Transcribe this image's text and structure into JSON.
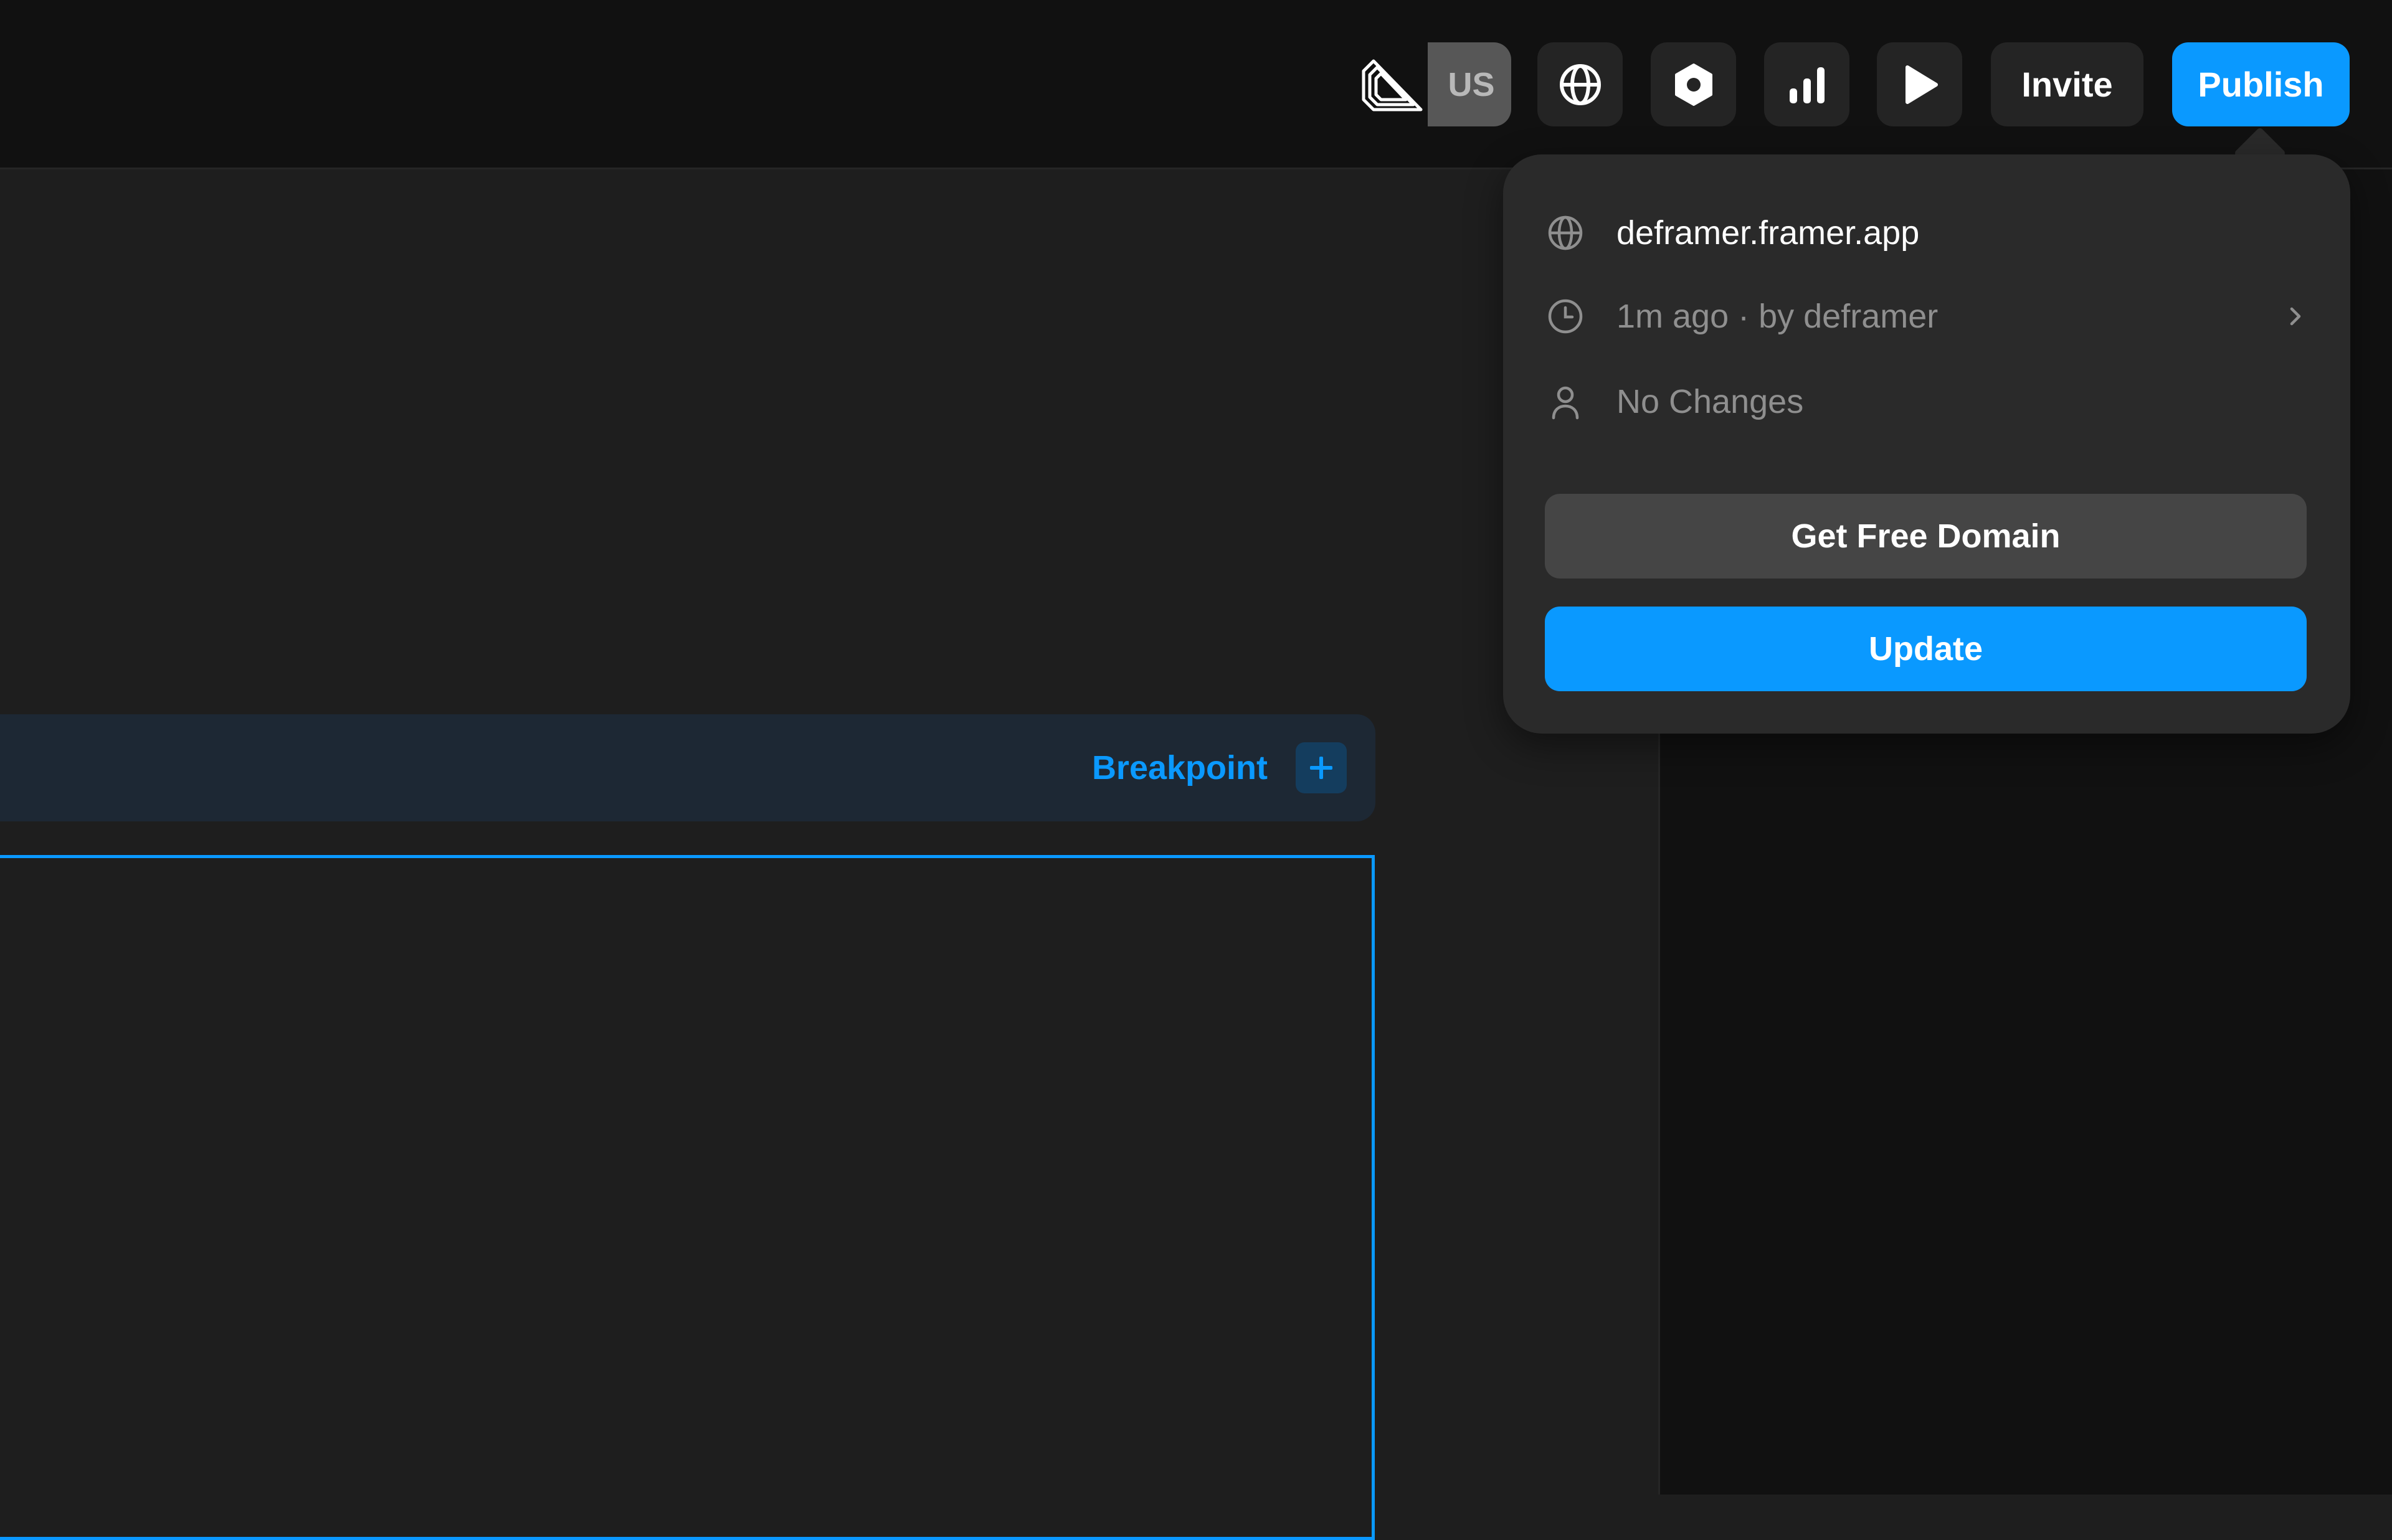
{
  "toolbar": {
    "logo_icon": "framer-layers-logo-icon",
    "user_initials": "US",
    "buttons": [
      {
        "name": "globe-icon"
      },
      {
        "name": "settings-hex-icon"
      },
      {
        "name": "analytics-bars-icon"
      },
      {
        "name": "play-icon"
      }
    ],
    "invite_label": "Invite",
    "publish_label": "Publish"
  },
  "canvas": {
    "breakpoint_label": "Breakpoint",
    "breakpoint_add_icon": "plus-icon"
  },
  "publish_popover": {
    "domain": "deframer.framer.app",
    "last_published": "1m ago · by deframer",
    "status": "No Changes",
    "get_domain_label": "Get Free Domain",
    "update_label": "Update"
  },
  "colors": {
    "accent": "#0a99ff",
    "toolbar_bg": "#111111",
    "canvas_bg": "#1e1e1e",
    "popover_bg": "#2a2a2a",
    "secondary_button_bg": "#454545",
    "breakpoint_bar_bg": "#1d2834"
  }
}
